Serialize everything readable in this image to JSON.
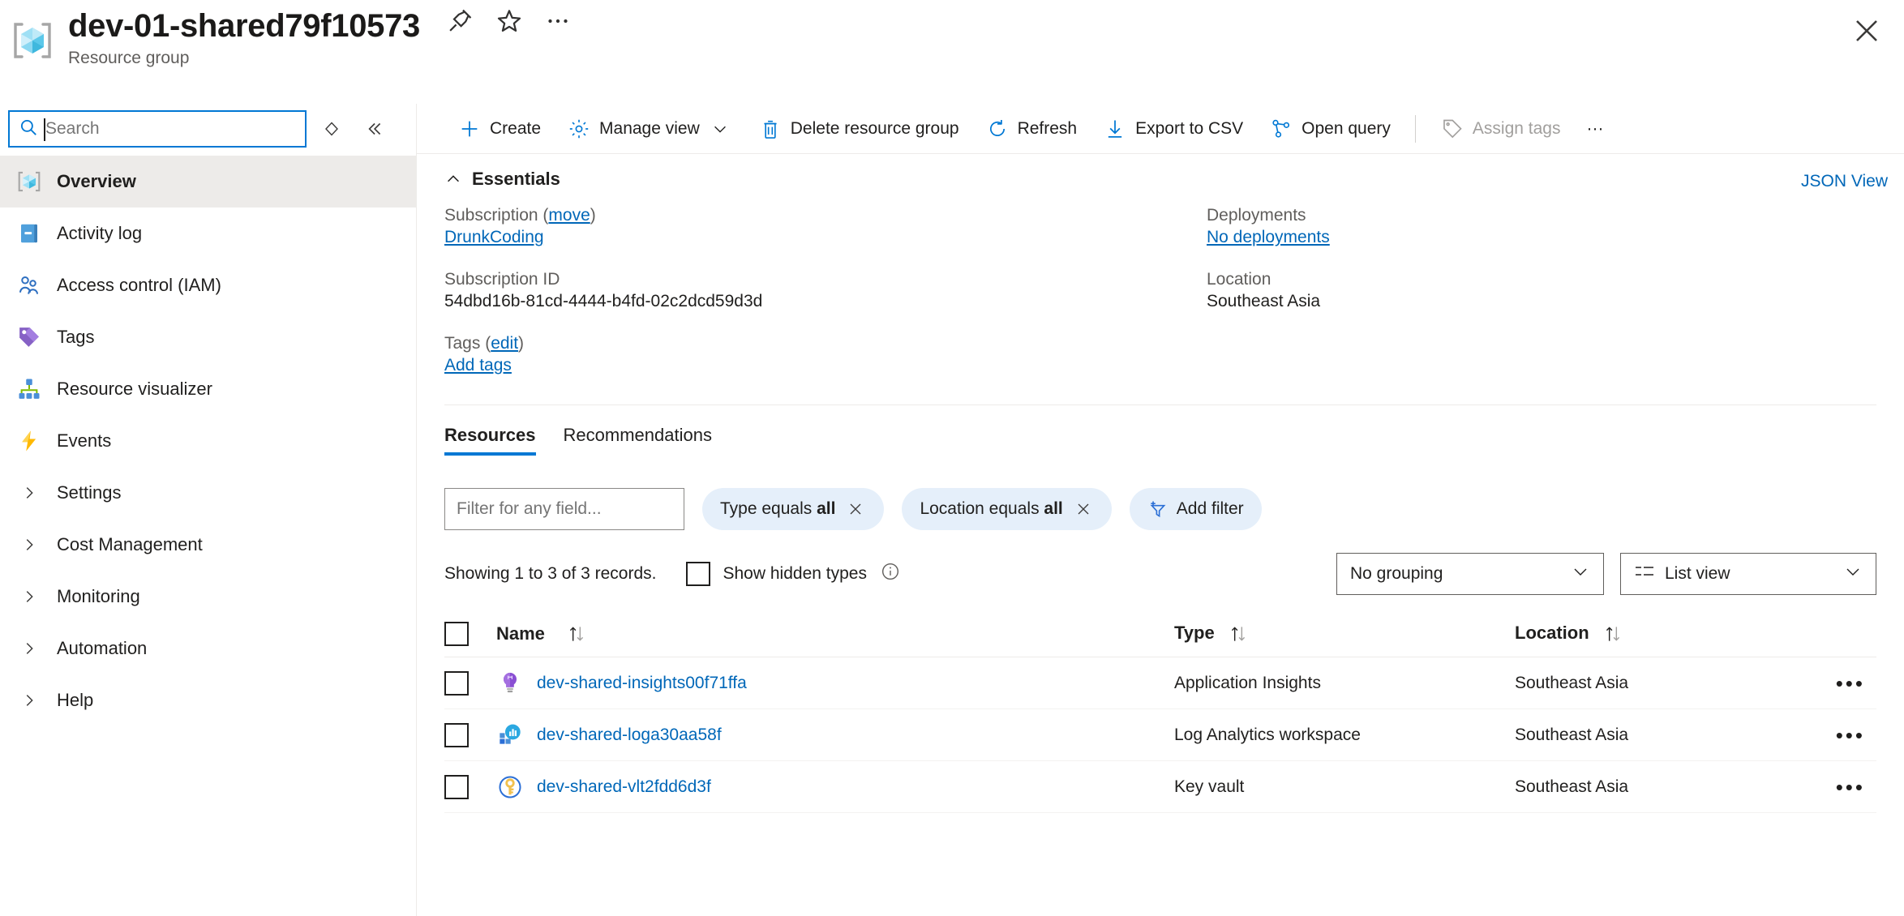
{
  "header": {
    "title": "dev-01-shared79f10573",
    "subtitle": "Resource group",
    "icons": {
      "pin": "pin-icon",
      "favorite": "star-icon",
      "more": "more-icon",
      "close": "close-icon"
    }
  },
  "sidebar": {
    "search": {
      "placeholder": "Search",
      "value": ""
    },
    "items": [
      {
        "label": "Overview",
        "icon": "resource-group-icon",
        "active": true,
        "expandable": false
      },
      {
        "label": "Activity log",
        "icon": "activity-log-icon",
        "active": false,
        "expandable": false
      },
      {
        "label": "Access control (IAM)",
        "icon": "access-control-icon",
        "active": false,
        "expandable": false
      },
      {
        "label": "Tags",
        "icon": "tags-icon",
        "active": false,
        "expandable": false
      },
      {
        "label": "Resource visualizer",
        "icon": "resource-visualizer-icon",
        "active": false,
        "expandable": false
      },
      {
        "label": "Events",
        "icon": "events-icon",
        "active": false,
        "expandable": false
      },
      {
        "label": "Settings",
        "icon": "chevron-right-icon",
        "active": false,
        "expandable": true
      },
      {
        "label": "Cost Management",
        "icon": "chevron-right-icon",
        "active": false,
        "expandable": true
      },
      {
        "label": "Monitoring",
        "icon": "chevron-right-icon",
        "active": false,
        "expandable": true
      },
      {
        "label": "Automation",
        "icon": "chevron-right-icon",
        "active": false,
        "expandable": true
      },
      {
        "label": "Help",
        "icon": "chevron-right-icon",
        "active": false,
        "expandable": true
      }
    ]
  },
  "toolbar": {
    "create": "Create",
    "manage_view": "Manage view",
    "delete_resource_group": "Delete resource group",
    "refresh": "Refresh",
    "export_csv": "Export to CSV",
    "open_query": "Open query",
    "assign_tags": "Assign tags",
    "more": "···"
  },
  "essentials": {
    "heading": "Essentials",
    "json_view": "JSON View",
    "subscription_label": "Subscription",
    "subscription_move": "move",
    "subscription_value": "DrunkCoding",
    "subscription_id_label": "Subscription ID",
    "subscription_id_value": "54dbd16b-81cd-4444-b4fd-02c2dcd59d3d",
    "tags_label": "Tags",
    "tags_edit": "edit",
    "tags_value": "Add tags",
    "deployments_label": "Deployments",
    "deployments_value": "No deployments",
    "location_label": "Location",
    "location_value": "Southeast Asia"
  },
  "tabs": [
    {
      "label": "Resources",
      "active": true
    },
    {
      "label": "Recommendations",
      "active": false
    }
  ],
  "filters": {
    "field_placeholder": "Filter for any field...",
    "chips": [
      {
        "prefix": "Type equals",
        "value": "all"
      },
      {
        "prefix": "Location equals",
        "value": "all"
      }
    ],
    "add_filter": "Add filter"
  },
  "records": {
    "showing_text": "Showing 1 to 3 of 3 records.",
    "show_hidden_types": "Show hidden types",
    "info_icon": "info-icon",
    "grouping": "No grouping",
    "view": "List view"
  },
  "table": {
    "columns": [
      {
        "label": "Name",
        "sortable": true
      },
      {
        "label": "Type",
        "sortable": true
      },
      {
        "label": "Location",
        "sortable": true
      }
    ],
    "rows": [
      {
        "name": "dev-shared-insights00f71ffa",
        "type": "Application Insights",
        "location": "Southeast Asia",
        "icon": "application-insights-icon"
      },
      {
        "name": "dev-shared-loga30aa58f",
        "type": "Log Analytics workspace",
        "location": "Southeast Asia",
        "icon": "log-analytics-icon"
      },
      {
        "name": "dev-shared-vlt2fdd6d3f",
        "type": "Key vault",
        "location": "Southeast Asia",
        "icon": "key-vault-icon"
      }
    ],
    "row_more": "•••"
  },
  "colors": {
    "accent": "#0078d4",
    "link": "#0067b8",
    "chip_bg": "#e5effa",
    "active_nav_bg": "#edebe9",
    "muted_text": "#605e5c",
    "disabled_text": "#a19f9d"
  }
}
